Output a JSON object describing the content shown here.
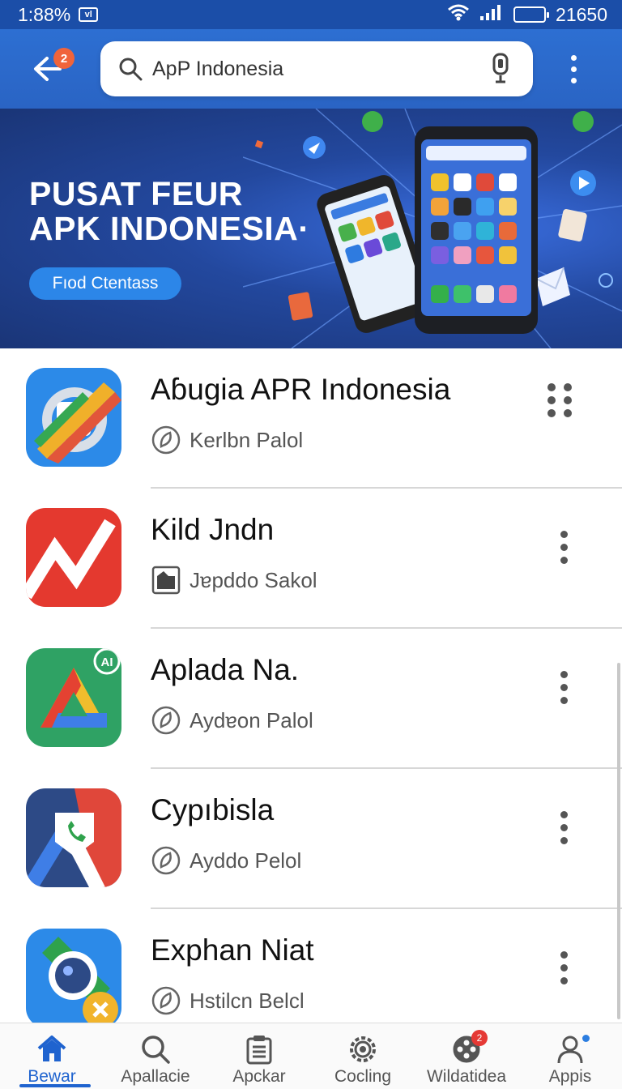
{
  "status_bar": {
    "time": "1:88%",
    "right_text": "21650"
  },
  "header": {
    "back_badge": "2",
    "search_value": "ApP Indonesia"
  },
  "banner": {
    "title_line1": "PUSAT FEUR",
    "title_line2": "APK INDONESIA·",
    "cta_label": "Fıod Ctentass"
  },
  "apps": [
    {
      "name": "Aɓugia APR Indonesia",
      "meta": "Kerlbn Palol",
      "meta_icon": "leaf-circle-icon",
      "menu": "grid"
    },
    {
      "name": "Kild Jndn",
      "meta": "Jɐpddo Sakol",
      "meta_icon": "image-icon",
      "menu": "dots"
    },
    {
      "name": "Aplada Na.",
      "meta": "Aydɐon Palol",
      "meta_icon": "leaf-circle-icon",
      "menu": "dots",
      "icon_badge": "AI"
    },
    {
      "name": "Cypıbisla",
      "meta": "Ayddo Pelol",
      "meta_icon": "leaf-circle-icon",
      "menu": "dots"
    },
    {
      "name": "Exphan Niat",
      "meta": "Hstilcn Belcl",
      "meta_icon": "leaf-circle-icon",
      "menu": "dots"
    }
  ],
  "bottom_nav": [
    {
      "label": "Bewar",
      "icon": "home-icon",
      "active": true
    },
    {
      "label": "Apallacie",
      "icon": "search-icon"
    },
    {
      "label": "Apckar",
      "icon": "clipboard-icon"
    },
    {
      "label": "Cocling",
      "icon": "gear-icon"
    },
    {
      "label": "Wildatidea",
      "icon": "film-reel-icon",
      "badge": "2"
    },
    {
      "label": "Appis",
      "icon": "person-icon",
      "dot": true
    }
  ],
  "colors": {
    "app_bar": "#2d6fd2",
    "status_bar": "#1b4ea8",
    "accent": "#1f63cf",
    "badge": "#f0643b"
  }
}
